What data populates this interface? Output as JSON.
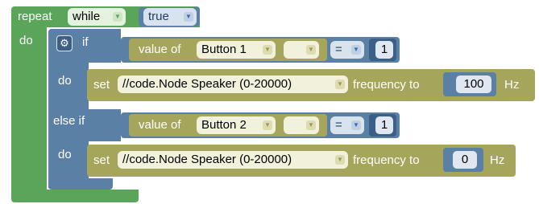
{
  "repeat_block": {
    "repeat_label": "repeat",
    "mode_value": "while",
    "condition_value": "true",
    "do_label": "do"
  },
  "if_block": {
    "if_label": "if",
    "do_label_1": "do",
    "else_if_label": "else if",
    "do_label_2": "do"
  },
  "condition_1": {
    "value_of_label": "value of",
    "component_value": "Button 1",
    "property_value": "",
    "operator_value": "=",
    "compare_value": "1"
  },
  "action_1": {
    "set_label": "set",
    "target_value": "//code.Node Speaker (0-20000)",
    "frequency_label": "frequency to",
    "frequency_value": "100",
    "unit_label": "Hz"
  },
  "condition_2": {
    "value_of_label": "value of",
    "component_value": "Button 2",
    "property_value": "",
    "operator_value": "=",
    "compare_value": "1"
  },
  "action_2": {
    "set_label": "set",
    "target_value": "//code.Node Speaker (0-20000)",
    "frequency_label": "frequency to",
    "frequency_value": "0",
    "unit_label": "Hz"
  },
  "colors": {
    "loop": "#5ba55b",
    "logic": "#5b80a5",
    "action": "#a5a55b"
  }
}
